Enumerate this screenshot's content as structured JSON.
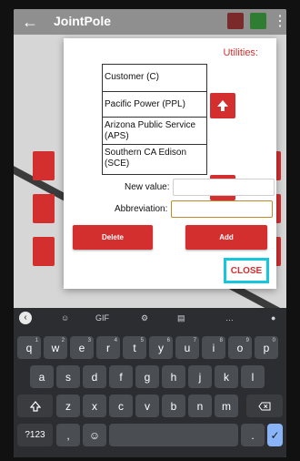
{
  "app": {
    "title": "JointPole",
    "back_icon": "back-arrow-icon",
    "more_icon": "more-vert-icon"
  },
  "dialog": {
    "title": "Utilities:",
    "list_items": [
      {
        "label": "Customer (C)"
      },
      {
        "label": "Pacific Power (PPL)"
      },
      {
        "label": "Arizona Public Service (APS)"
      },
      {
        "label": "Southern CA Edison (SCE)"
      }
    ],
    "fields": {
      "new_value_label": "New value:",
      "new_value": "",
      "abbreviation_label": "Abbreviation:",
      "abbreviation": ""
    },
    "buttons": {
      "delete": "Delete",
      "add": "Add",
      "close": "CLOSE"
    }
  },
  "keyboard": {
    "suggestions": {
      "gif": "GIF"
    },
    "row1": [
      {
        "label": "q",
        "num": "1"
      },
      {
        "label": "w",
        "num": "2"
      },
      {
        "label": "e",
        "num": "3"
      },
      {
        "label": "r",
        "num": "4"
      },
      {
        "label": "t",
        "num": "5"
      },
      {
        "label": "y",
        "num": "6"
      },
      {
        "label": "u",
        "num": "7"
      },
      {
        "label": "i",
        "num": "8"
      },
      {
        "label": "o",
        "num": "9"
      },
      {
        "label": "p",
        "num": "0"
      }
    ],
    "row2": [
      "a",
      "s",
      "d",
      "f",
      "g",
      "h",
      "j",
      "k",
      "l"
    ],
    "row3": [
      "z",
      "x",
      "c",
      "v",
      "b",
      "n",
      "m"
    ],
    "row4": {
      "sym": "?123",
      "comma": ",",
      "period": "."
    }
  },
  "colors": {
    "accent_red": "#d32f2f",
    "highlight_cyan": "#14c7dd",
    "keyboard_bg": "#2b2d30",
    "key_bg": "#4a4d52",
    "enter_blue": "#8ab4f8"
  }
}
